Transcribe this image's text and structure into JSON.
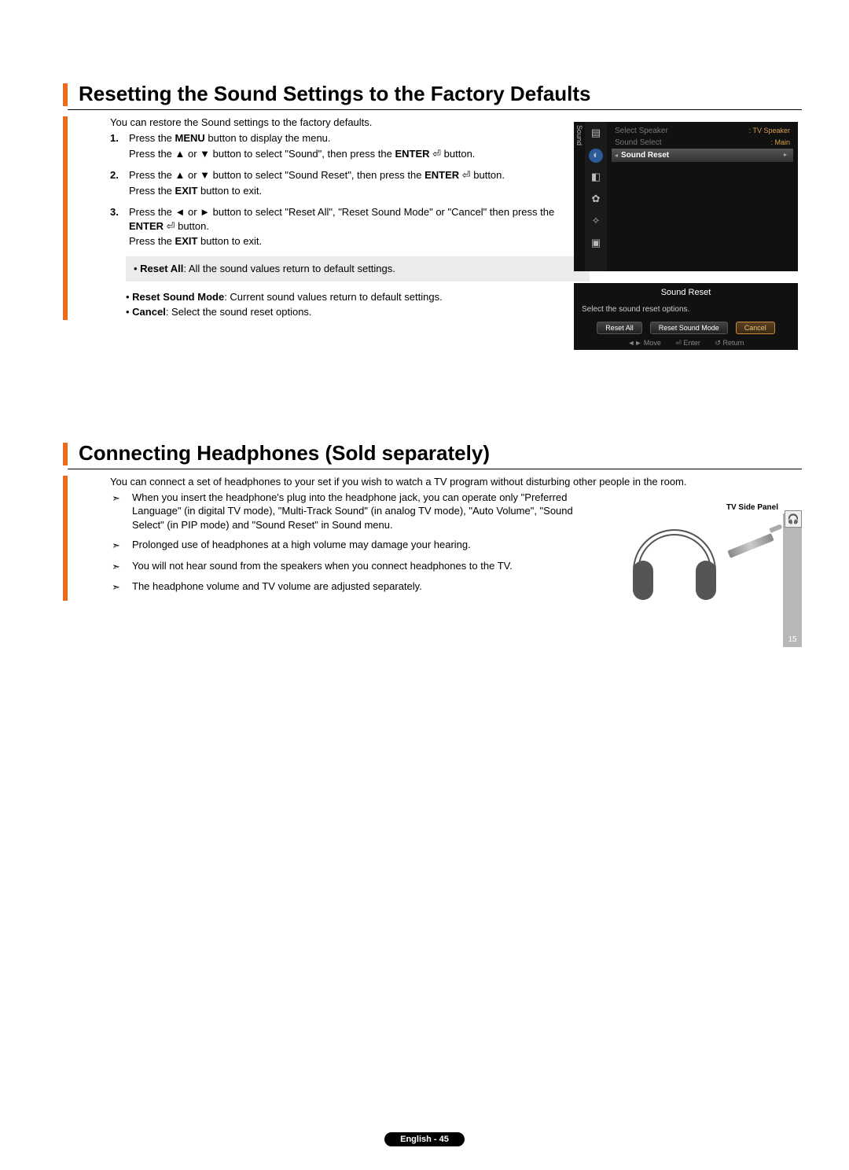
{
  "section1": {
    "title": "Resetting the Sound Settings to the Factory Defaults",
    "intro": "You can restore the Sound settings to the factory defaults.",
    "step1_num": "1.",
    "step1_line1_a": "Press the ",
    "step1_line1_b": "MENU",
    "step1_line1_c": " button to display the menu.",
    "step1_line2_a": "Press the ▲ or ▼ button to select \"Sound\", then press the ",
    "step1_line2_b": "ENTER",
    "step1_line2_c": " ⏎ button.",
    "step2_num": "2.",
    "step2_line1_a": "Press the ▲ or ▼ button to select \"Sound Reset\", then press the ",
    "step2_line1_b": "ENTER",
    "step2_line1_c": " ⏎ button.",
    "step2_line2_a": "Press the ",
    "step2_line2_b": "EXIT",
    "step2_line2_c": " button to exit.",
    "step3_num": "3.",
    "step3_line1_a": "Press the ◄ or ► button to select \"Reset All\", \"Reset Sound Mode\" or \"Cancel\" then press the ",
    "step3_line1_b": "ENTER",
    "step3_line1_c": " ⏎ button.",
    "step3_line2_a": "Press the ",
    "step3_line2_b": "EXIT",
    "step3_line2_c": " button to exit.",
    "option1_label": "Reset All",
    "option1_text": ": All the sound values return to default settings.",
    "option2_label": "Reset Sound Mode",
    "option2_text": ": Current sound values return to default settings.",
    "option3_label": "Cancel",
    "option3_text": ": Select the sound reset options."
  },
  "osd1": {
    "sidelabel": "Sound",
    "row1_label": "Select Speaker",
    "row1_value": ": TV Speaker",
    "row2_label": "Sound Select",
    "row2_value": ": Main",
    "row3_label": "Sound Reset"
  },
  "osd2": {
    "title": "Sound Reset",
    "subtitle": "Select the sound reset options.",
    "btn1": "Reset All",
    "btn2": "Reset Sound Mode",
    "btn3": "Cancel",
    "foot_move": "◄► Move",
    "foot_enter": "⏎ Enter",
    "foot_return": "↺ Return"
  },
  "section2": {
    "title": "Connecting Headphones (Sold separately)",
    "intro": "You can connect a set of headphones to your set if you wish to watch a TV program without disturbing other people in the room.",
    "note_mark": "➣",
    "note1": "When you insert the headphone's plug into the headphone jack, you can operate only \"Preferred Language\" (in digital TV mode), \"Multi-Track Sound\" (in analog TV mode), \"Auto Volume\", \"Sound Select\" (in PIP mode) and \"Sound Reset\" in Sound menu.",
    "note2": "Prolonged use of headphones at a high volume may damage your hearing.",
    "note3": "You will not hear sound from the speakers when you connect headphones to the TV.",
    "note4": "The headphone volume and TV volume are adjusted separately."
  },
  "headphone_fig": {
    "caption": "TV Side Panel",
    "port_symbol": "🎧",
    "panel_num": "15"
  },
  "footer": {
    "text": "English - 45"
  }
}
